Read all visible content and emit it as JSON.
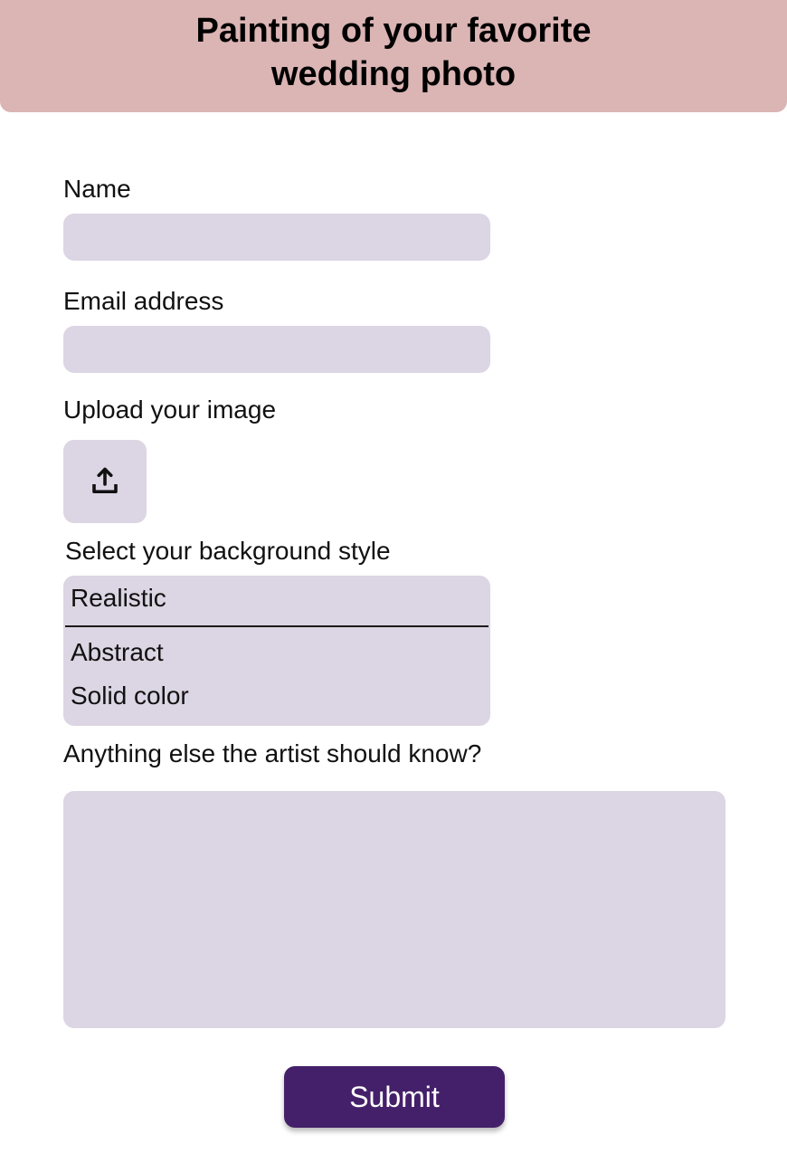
{
  "header": {
    "title": "Painting of your favorite wedding photo"
  },
  "form": {
    "name_label": "Name",
    "name_value": "",
    "email_label": "Email address",
    "email_value": "",
    "upload_label": "Upload your image",
    "upload_icon": "upload-icon",
    "background_label": "Select your background style",
    "background_options": [
      "Realistic",
      "Abstract",
      "Solid color"
    ],
    "notes_label": "Anything else the artist should know?",
    "notes_value": "",
    "submit_label": "Submit"
  },
  "colors": {
    "header_bg": "#dbb4b4",
    "field_bg": "#dcd5e3",
    "submit_bg": "#45206a"
  }
}
